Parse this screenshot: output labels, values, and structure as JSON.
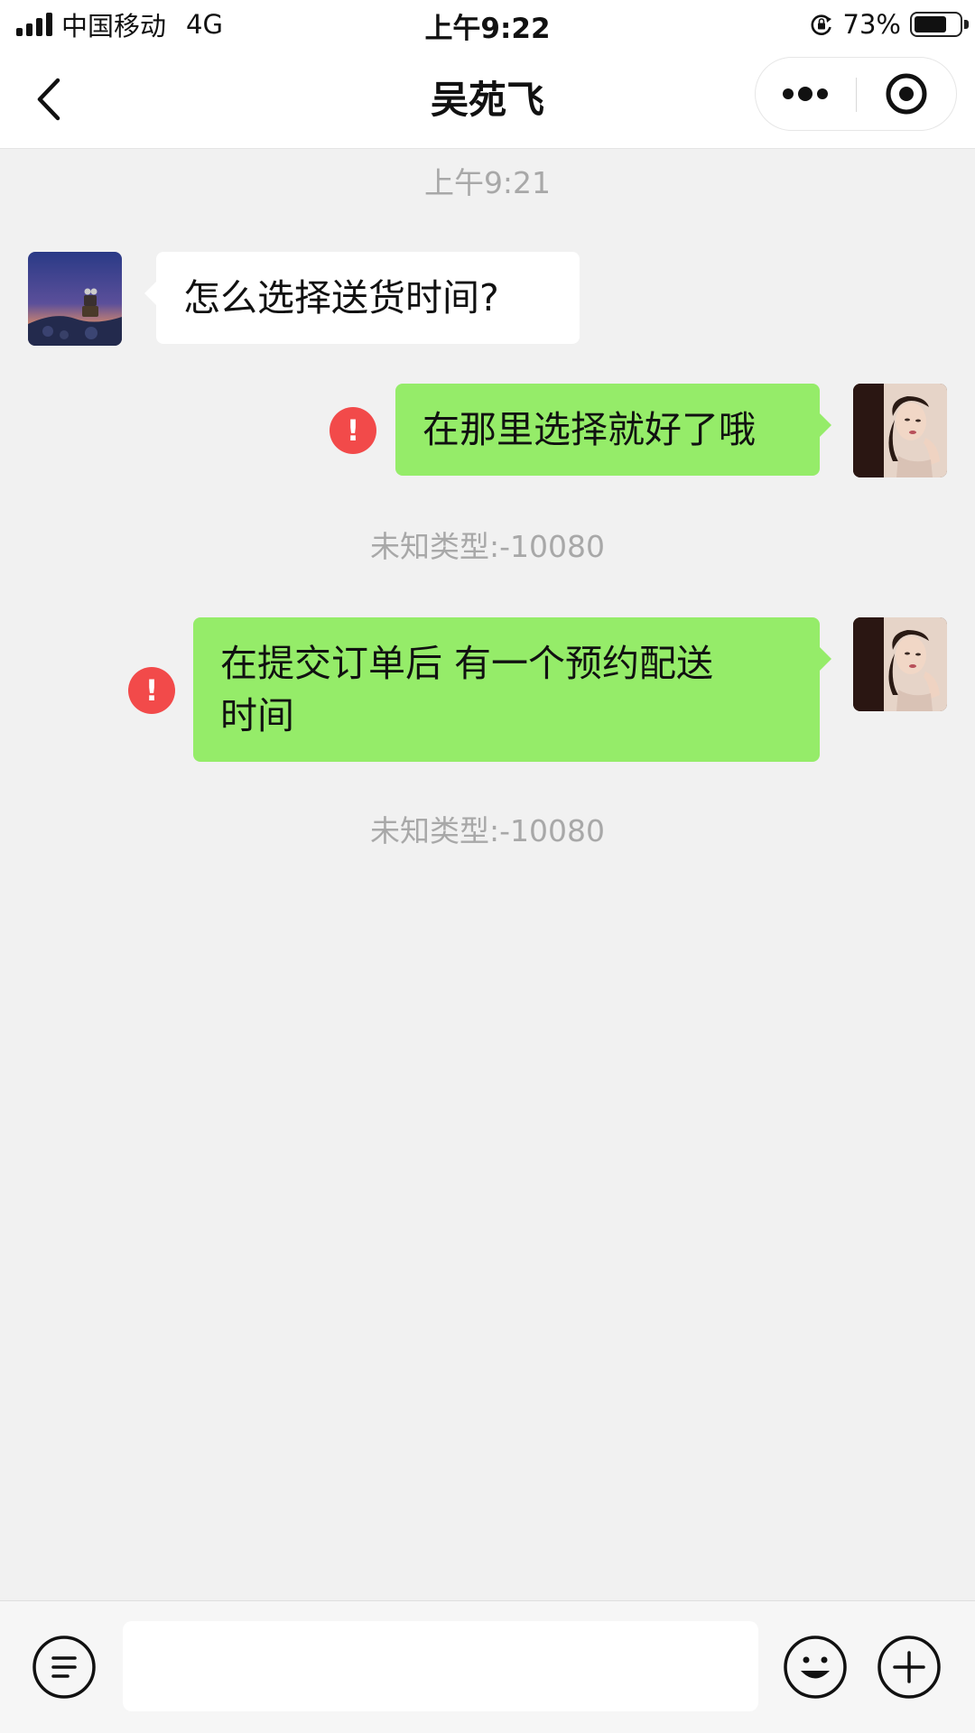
{
  "status_bar": {
    "carrier": "中国移动",
    "network": "4G",
    "time": "上午9:22",
    "battery_percent": "73%",
    "battery_level": 0.73
  },
  "nav": {
    "title": "吴苑飞",
    "back_icon": "chevron-left-icon",
    "more_icon": "more-dots-icon",
    "close_icon": "target-circle-icon"
  },
  "chat": {
    "timestamp": "上午9:21",
    "messages": [
      {
        "direction": "incoming",
        "text": "怎么选择送货时间?",
        "avatar": "wall-e-night-sky-avatar"
      },
      {
        "direction": "outgoing",
        "text": "在那里选择就好了哦",
        "avatar": "woman-portrait-avatar",
        "send_failed": true,
        "error_mark": "!"
      },
      {
        "direction": "system",
        "text": "未知类型:-10080"
      },
      {
        "direction": "outgoing",
        "text_line1": "在提交订单后 有一个预约配送",
        "text_line2": "时间",
        "avatar": "woman-portrait-avatar",
        "send_failed": true,
        "error_mark": "!"
      },
      {
        "direction": "system",
        "text": "未知类型:-10080"
      }
    ]
  },
  "input_bar": {
    "text_value": "",
    "voice_icon": "keyboard-lines-icon",
    "emoji_icon": "emoji-smile-icon",
    "plus_icon": "plus-circle-icon"
  },
  "colors": {
    "chat_background": "#f1f1f1",
    "outgoing_bubble": "#95ec69",
    "incoming_bubble": "#ffffff",
    "error_badge": "#f24a4a",
    "system_text": "#a8a8a8"
  }
}
